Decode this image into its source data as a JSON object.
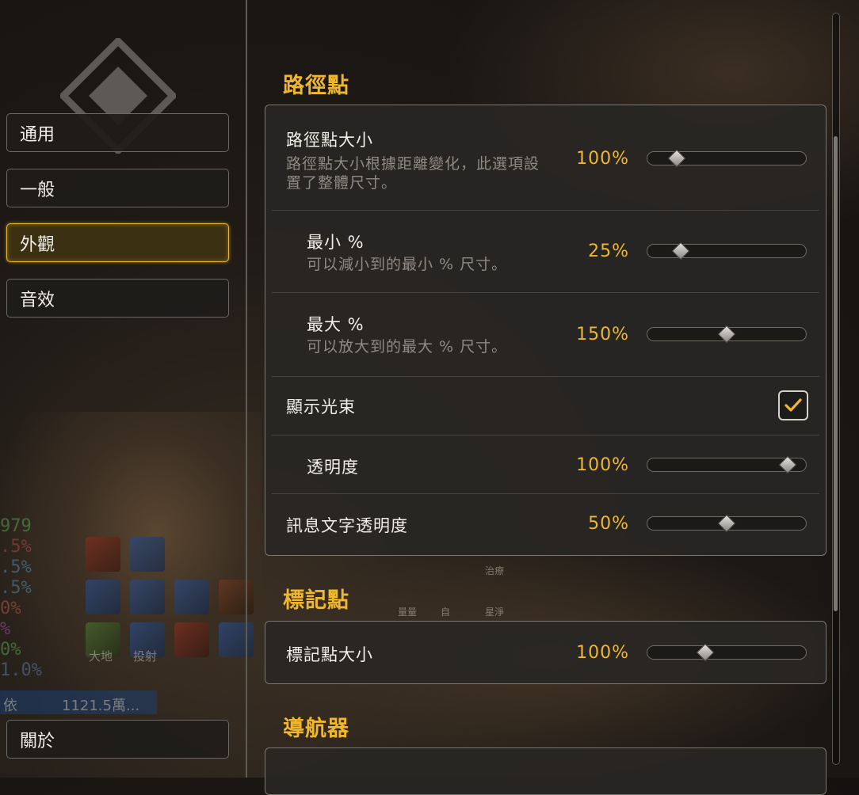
{
  "nav": {
    "items": [
      {
        "label": "通用",
        "active": false
      },
      {
        "label": "一般",
        "active": false
      },
      {
        "label": "外觀",
        "active": true
      },
      {
        "label": "音效",
        "active": false
      }
    ],
    "about_label": "關於"
  },
  "sections": {
    "waypoint": {
      "title": "路徑點",
      "size": {
        "label": "路徑點大小",
        "description": "路徑點大小根據距離變化，此選項設置了整體尺寸。",
        "value_text": "100%",
        "value": 0.15
      },
      "min": {
        "label": "最小 %",
        "description": "可以減小到的最小 % 尺寸。",
        "value_text": "25%",
        "value": 0.18
      },
      "max": {
        "label": "最大 %",
        "description": "可以放大到的最大 % 尺寸。",
        "value_text": "150%",
        "value": 0.5
      },
      "show_beam": {
        "label": "顯示光束",
        "checked": true
      },
      "opacity": {
        "label": "透明度",
        "value_text": "100%",
        "value": 0.93
      },
      "text_opacity": {
        "label": "訊息文字透明度",
        "value_text": "50%",
        "value": 0.5
      }
    },
    "marker": {
      "title": "標記點",
      "size": {
        "label": "標記點大小",
        "value_text": "100%",
        "value": 0.35
      }
    },
    "navigator": {
      "title": "導航器"
    }
  },
  "background": {
    "stats": [
      "979",
      ".5%",
      ".5%",
      ".5%",
      "0%",
      "%",
      "0%",
      "1.0%"
    ],
    "icon_labels": [
      "大地",
      "投射",
      "治療",
      "量量",
      "自",
      "星淨"
    ],
    "bar_left": "依",
    "bar_right": "1121.5萬..."
  },
  "colors": {
    "accent": "#f0b72c",
    "active_border": "#e8b530",
    "text": "#f2efe8",
    "muted": "#8f8a82"
  }
}
